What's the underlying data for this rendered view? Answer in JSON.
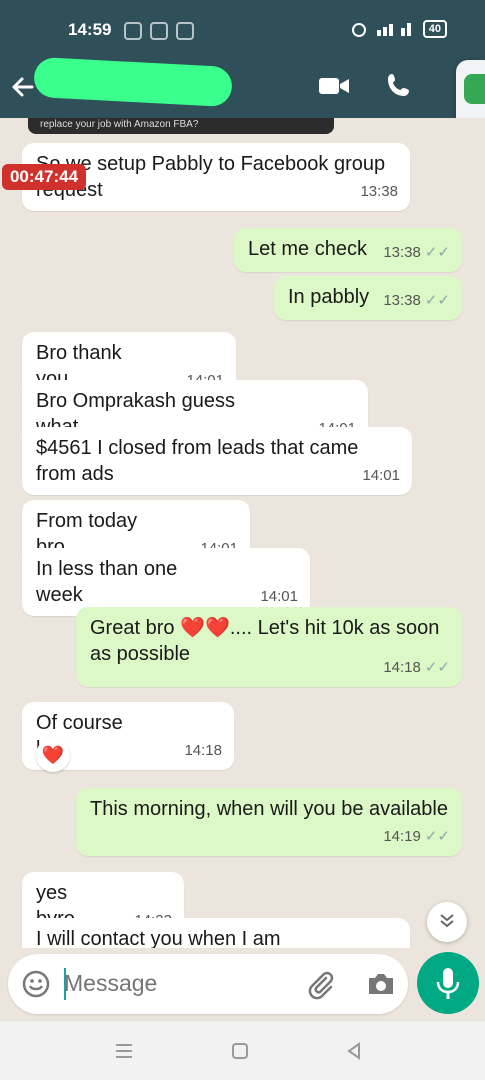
{
  "status_bar": {
    "time": "14:59",
    "battery": "40"
  },
  "timer_badge": "00:47:44",
  "quoted_preview": "replace your job with Amazon FBA?",
  "messages": [
    {
      "text": "So we setup Pabbly to Facebook group request",
      "time": "13:38",
      "out": false
    },
    {
      "text": "Let me check",
      "time": "13:38",
      "out": true
    },
    {
      "text": "In pabbly",
      "time": "13:38",
      "out": true
    },
    {
      "text": "Bro thank you",
      "time": "14:01",
      "out": false
    },
    {
      "text": "Bro Omprakash guess what",
      "time": "14:01",
      "out": false
    },
    {
      "text": "$4561 I closed from leads that came from ads",
      "time": "14:01",
      "out": false
    },
    {
      "text": "From today bro",
      "time": "14:01",
      "out": false
    },
    {
      "text": "In less than one week",
      "time": "14:01",
      "out": false
    },
    {
      "text": "Great bro ❤️❤️.... Let's hit 10k as soon as possible",
      "time": "14:18",
      "out": true
    },
    {
      "text": "Of course bro",
      "time": "14:18",
      "out": false
    },
    {
      "text": "This morning, when will you be available",
      "time": "14:19",
      "out": true
    },
    {
      "text": "yes bvro",
      "time": "14:23",
      "out": false
    },
    {
      "text": "I will contact you when I am",
      "time": "",
      "out": false
    }
  ],
  "reaction": "❤️",
  "input": {
    "placeholder": "Message"
  },
  "colors": {
    "header": "#2f4f59",
    "outgoing": "#dcf8c6",
    "incoming": "#ffffff",
    "accent": "#00a884",
    "background": "#ece5dd"
  },
  "icons": [
    "back-arrow-icon",
    "video-call-icon",
    "voice-call-icon",
    "emoji-icon",
    "attach-icon",
    "camera-icon",
    "mic-icon",
    "double-tick-icon",
    "chevron-double-down-icon",
    "menu-nav-icon",
    "home-nav-icon",
    "back-nav-icon"
  ]
}
